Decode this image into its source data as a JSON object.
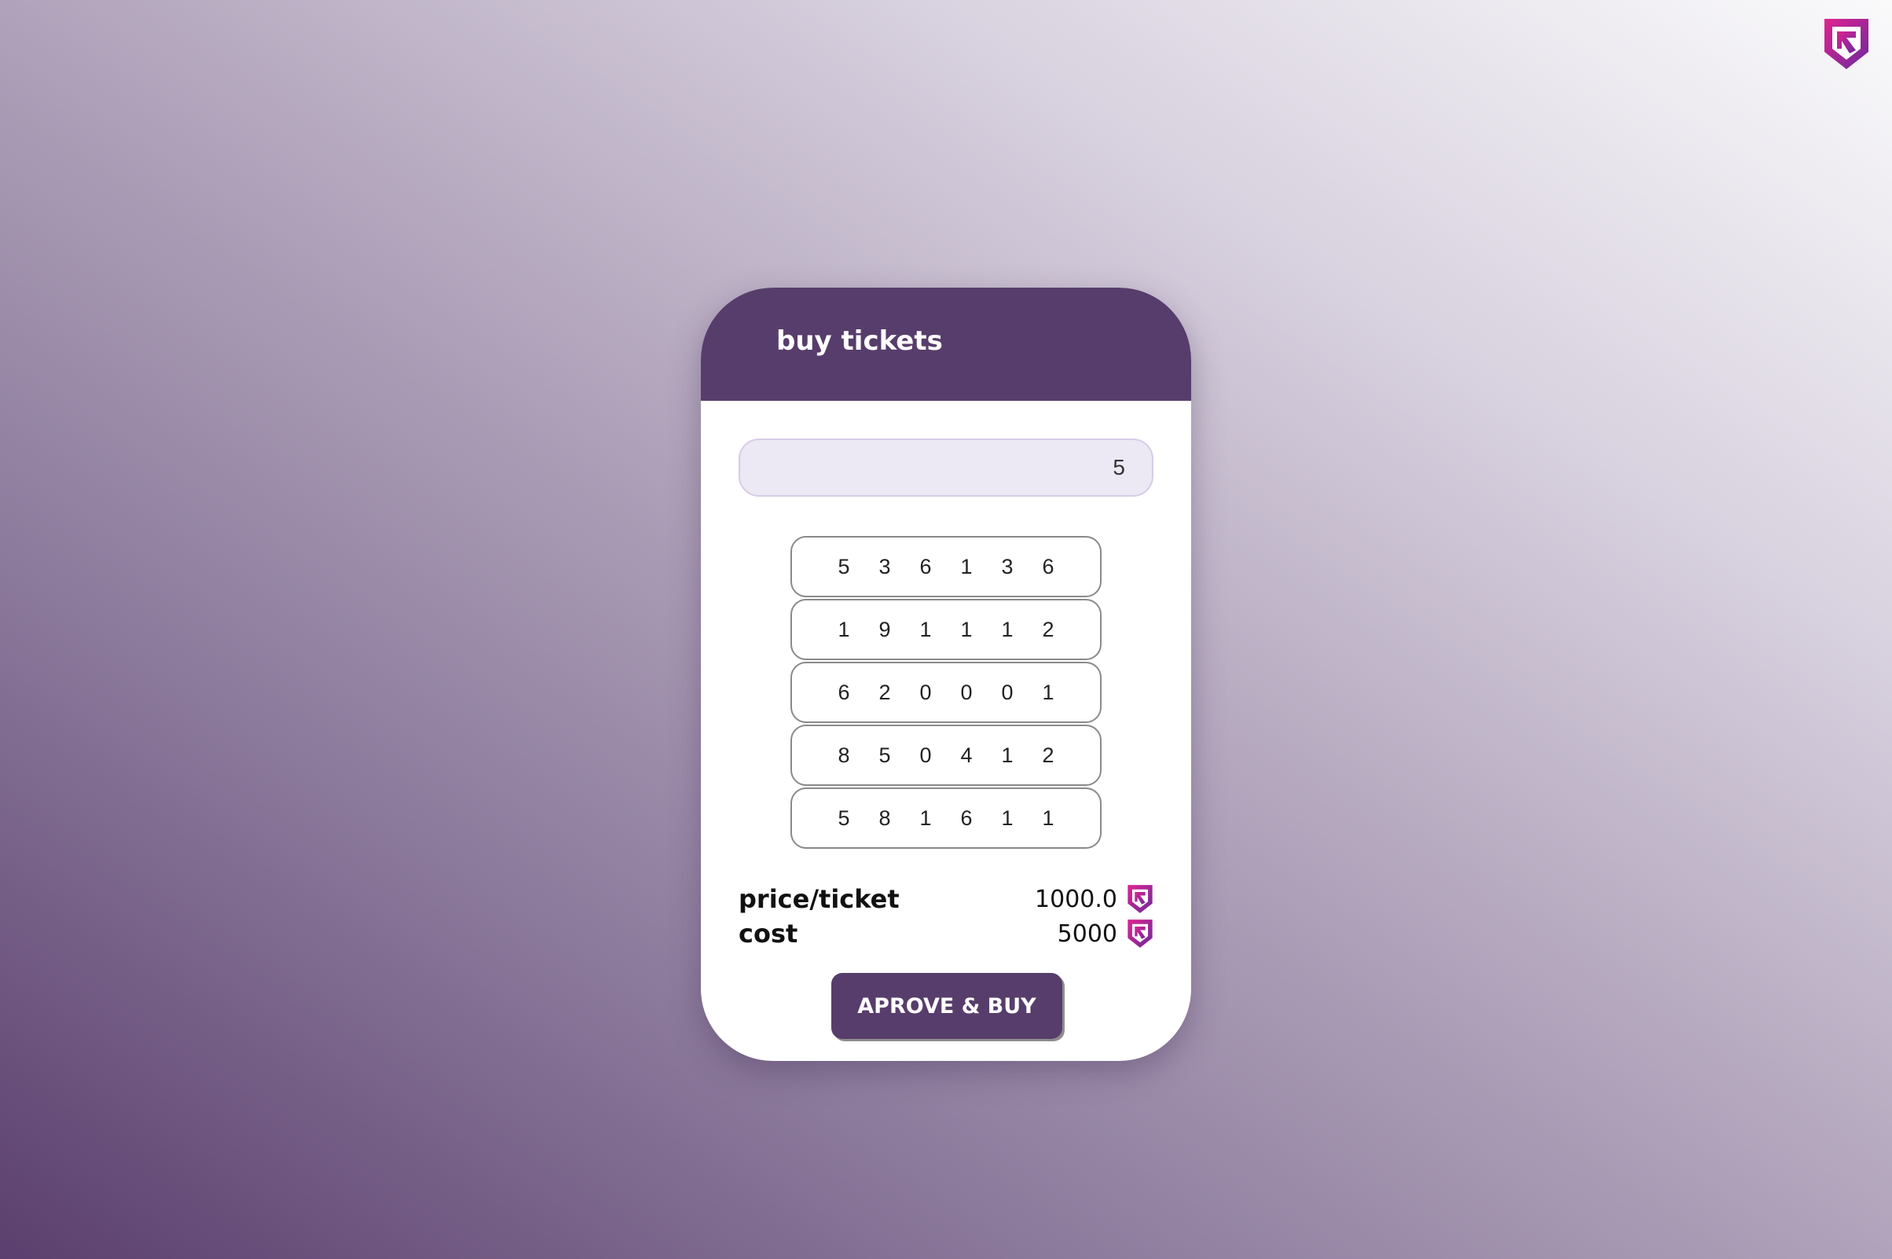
{
  "page": {
    "corner_logo_icon": "app-logo-icon"
  },
  "card": {
    "title": "buy tickets",
    "quantity": {
      "value": "5"
    },
    "tickets": [
      [
        "5",
        "3",
        "6",
        "1",
        "3",
        "6"
      ],
      [
        "1",
        "9",
        "1",
        "1",
        "1",
        "2"
      ],
      [
        "6",
        "2",
        "0",
        "0",
        "0",
        "1"
      ],
      [
        "8",
        "5",
        "0",
        "4",
        "1",
        "2"
      ],
      [
        "5",
        "8",
        "1",
        "6",
        "1",
        "1"
      ]
    ],
    "summary": {
      "price_label": "price/ticket",
      "price_value": "1000.0",
      "cost_label": "cost",
      "cost_value": "5000",
      "token_icon": "token-icon"
    },
    "buy_button_label": "APROVE & BUY"
  },
  "colors": {
    "brand_purple": "#573d6b",
    "field_bg": "#ece8f4",
    "logo_gradient_start": "#e0238f",
    "logo_gradient_end": "#6b2a9e"
  }
}
